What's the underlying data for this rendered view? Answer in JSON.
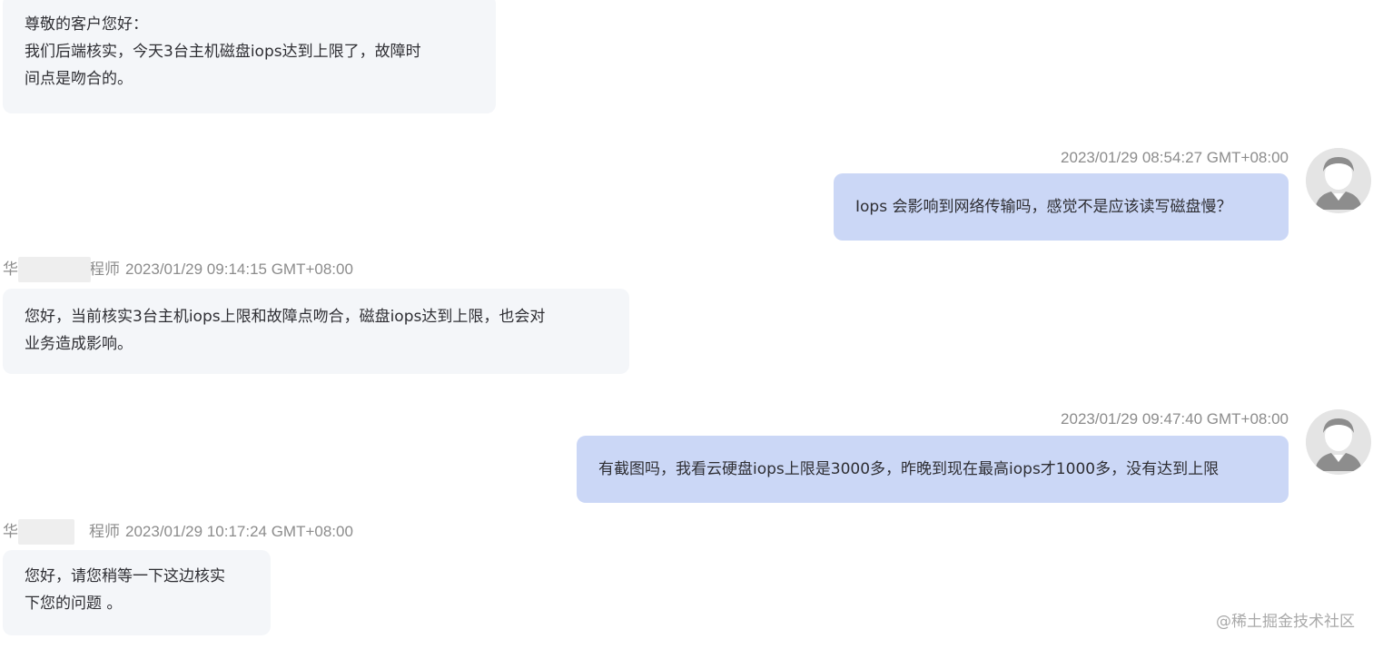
{
  "messages": [
    {
      "side": "in",
      "lines": [
        "尊敬的客户您好：",
        "我们后端核实，今天3台主机磁盘iops达到上限了，故障时",
        "间点是吻合的。"
      ]
    },
    {
      "side": "out",
      "timestamp": "2023/01/29 08:54:27 GMT+08:00",
      "lines": [
        "Iops 会影响到网络传输吗，感觉不是应该读写磁盘慢？"
      ]
    },
    {
      "side": "in",
      "sender": "华为云工程师",
      "sender_visible_head": "华",
      "sender_visible_tail": "程师",
      "timestamp": "2023/01/29 09:14:15 GMT+08:00",
      "lines": [
        "您好，当前核实3台主机iops上限和故障点吻合，磁盘iops达到上限，也会对",
        "业务造成影响。"
      ]
    },
    {
      "side": "out",
      "timestamp": "2023/01/29 09:47:40 GMT+08:00",
      "lines": [
        "有截图吗，我看云硬盘iops上限是3000多，昨晚到现在最高iops才1000多，没有达到上限"
      ]
    },
    {
      "side": "in",
      "sender_visible_head": "华",
      "sender_visible_tail": "程师",
      "timestamp": "2023/01/29 10:17:24 GMT+08:00",
      "lines": [
        "您好，请您稍等一下这边核实",
        "下您的问题 。"
      ]
    }
  ],
  "watermark": "@稀土掘金技术社区",
  "colors": {
    "incoming_bubble": "#f4f6f9",
    "outgoing_bubble": "#cbd7f6",
    "meta_text": "#8c8c8c"
  }
}
